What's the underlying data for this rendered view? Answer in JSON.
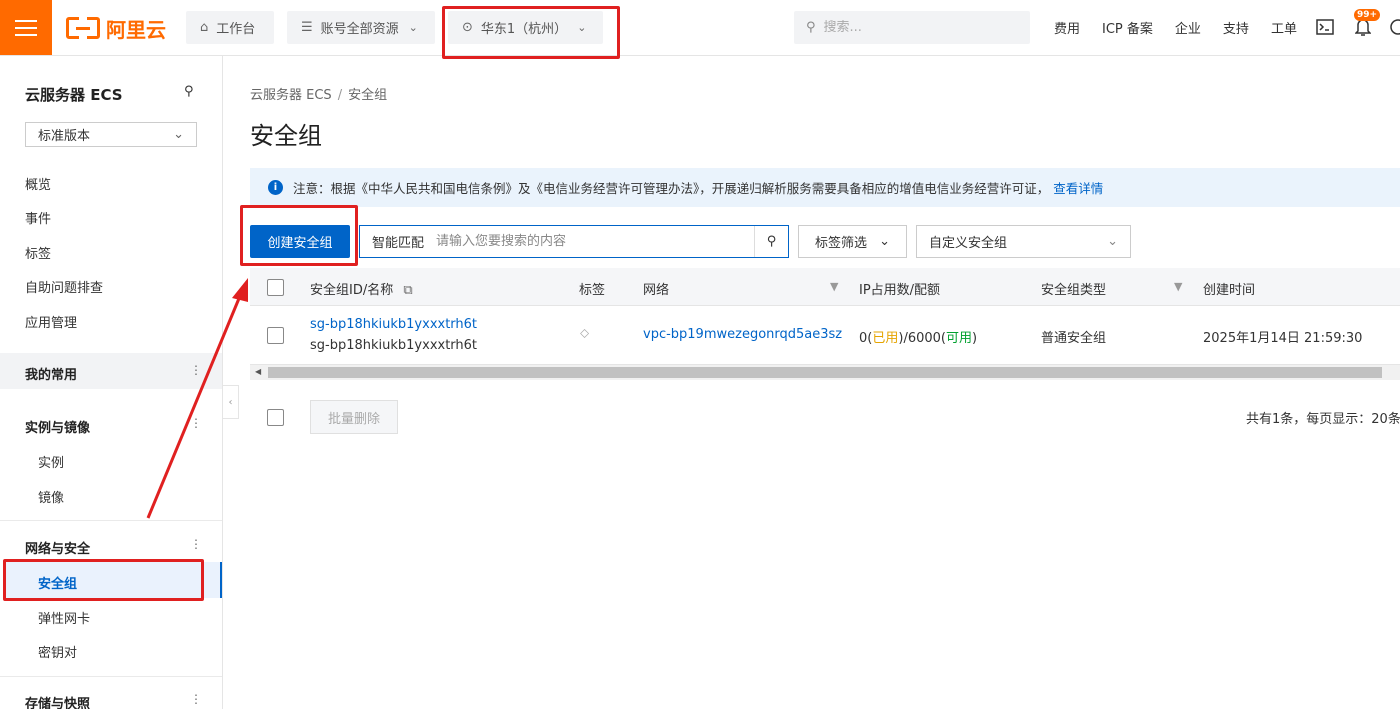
{
  "header": {
    "logo_text": "阿里云",
    "workbench": "工作台",
    "resources": "账号全部资源",
    "region": "华东1（杭州）",
    "search_placeholder": "搜索...",
    "links": [
      "费用",
      "ICP 备案",
      "企业",
      "支持",
      "工单"
    ],
    "notification_count": "99+"
  },
  "sidebar": {
    "title": "云服务器 ECS",
    "version": "标准版本",
    "items": [
      "概览",
      "事件",
      "标签",
      "自助问题排查",
      "应用管理"
    ],
    "favorites": "我的常用",
    "group_instances": "实例与镜像",
    "instances_items": [
      "实例",
      "镜像"
    ],
    "group_network": "网络与安全",
    "network_items": [
      "安全组",
      "弹性网卡",
      "密钥对"
    ],
    "group_storage": "存储与快照"
  },
  "main": {
    "breadcrumb": [
      "云服务器 ECS",
      "安全组"
    ],
    "title": "安全组",
    "notice_text": "注意：根据《中华人民共和国电信条例》及《电信业务经营许可管理办法》，开展递归解析服务需要具备相应的增值电信业务经营许可证，",
    "notice_link": "查看详情",
    "create_button": "创建安全组",
    "search_mode": "智能匹配",
    "search_placeholder": "请输入您要搜索的内容",
    "tag_filter": "标签筛选",
    "type_select": "自定义安全组"
  },
  "table": {
    "columns": [
      "安全组ID/名称",
      "标签",
      "网络",
      "IP占用数/配额",
      "安全组类型",
      "创建时间"
    ],
    "rows": [
      {
        "id": "sg-bp18hkiukb1yxxxtrh6t",
        "name": "sg-bp18hkiukb1yxxxtrh6t",
        "network": "vpc-bp19mwezegonrqd5ae3sz",
        "ip_used": "0",
        "ip_used_label": "已用",
        "ip_quota": "6000",
        "ip_quota_label": "可用",
        "type": "普通安全组",
        "created": "2025年1月14日 21:59:30"
      }
    ],
    "bulk_delete": "批量删除",
    "pager_info": "共有1条，每页显示：20条"
  },
  "colors": {
    "brand": "#ff6a00",
    "primary": "#0064c8",
    "annotation": "#e02020"
  }
}
